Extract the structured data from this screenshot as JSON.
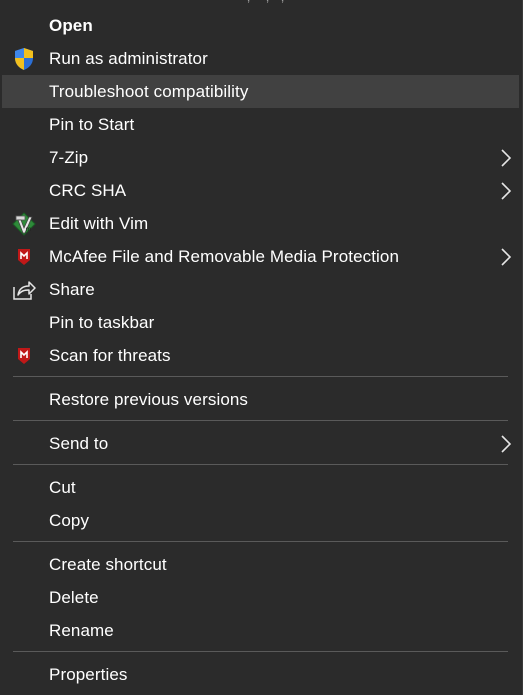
{
  "top_text": "' , ' -, '-, '-",
  "items": {
    "open": {
      "label": "Open",
      "icon": "none",
      "submenu": false
    },
    "run_admin": {
      "label": "Run as administrator",
      "icon": "uac-shield-icon",
      "submenu": false
    },
    "troubleshoot": {
      "label": "Troubleshoot compatibility",
      "icon": "none",
      "submenu": false
    },
    "pin_start": {
      "label": "Pin to Start",
      "icon": "none",
      "submenu": false
    },
    "zip": {
      "label": "7-Zip",
      "icon": "none",
      "submenu": true
    },
    "crc": {
      "label": "CRC SHA",
      "icon": "none",
      "submenu": true
    },
    "vim": {
      "label": "Edit with Vim",
      "icon": "vim-icon",
      "submenu": false
    },
    "mcafee_file": {
      "label": "McAfee File and Removable Media Protection",
      "icon": "mcafee-icon",
      "submenu": true
    },
    "share": {
      "label": "Share",
      "icon": "share-icon",
      "submenu": false
    },
    "pin_taskbar": {
      "label": "Pin to taskbar",
      "icon": "none",
      "submenu": false
    },
    "scan": {
      "label": "Scan for threats",
      "icon": "mcafee-icon",
      "submenu": false
    },
    "restore": {
      "label": "Restore previous versions",
      "icon": "none",
      "submenu": false
    },
    "send_to": {
      "label": "Send to",
      "icon": "none",
      "submenu": true
    },
    "cut": {
      "label": "Cut",
      "icon": "none",
      "submenu": false
    },
    "copy": {
      "label": "Copy",
      "icon": "none",
      "submenu": false
    },
    "create_shortcut": {
      "label": "Create shortcut",
      "icon": "none",
      "submenu": false
    },
    "delete": {
      "label": "Delete",
      "icon": "none",
      "submenu": false
    },
    "rename": {
      "label": "Rename",
      "icon": "none",
      "submenu": false
    },
    "properties": {
      "label": "Properties",
      "icon": "none",
      "submenu": false
    }
  },
  "highlighted_item": "Troubleshoot compatibility",
  "colors": {
    "menu_background": "#2b2b2b",
    "highlight_background": "#414141",
    "text": "#ffffff",
    "separator": "#5a5a5a",
    "mcafee_red": "#c01818",
    "uac_blue": "#2b6fd6",
    "uac_yellow": "#f2c01e",
    "vim_green": "#2e8b3a"
  }
}
